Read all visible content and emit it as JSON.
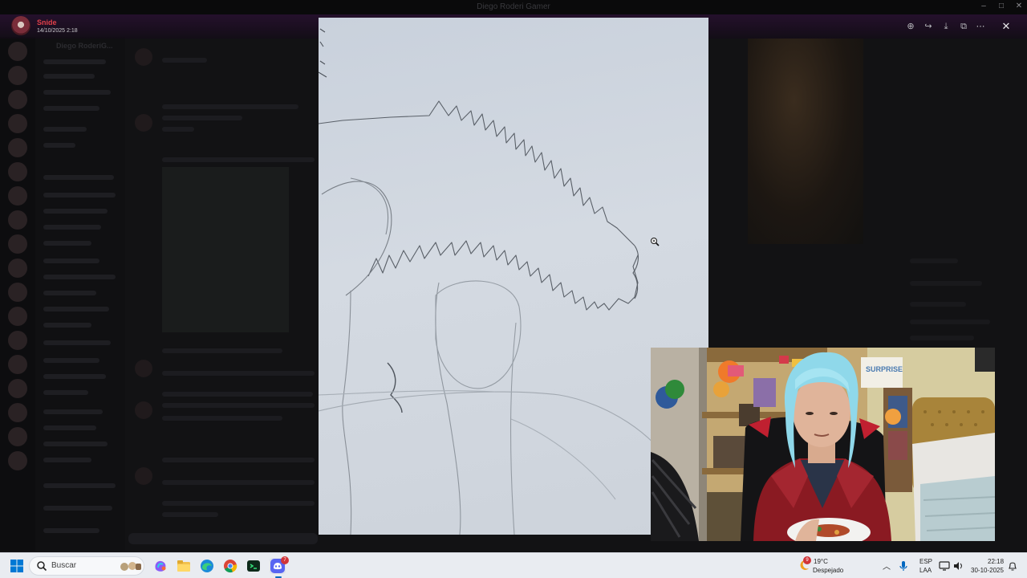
{
  "window": {
    "title": "Diego Roderi Gamer"
  },
  "viewer": {
    "uploader_name": "Snide",
    "uploader_date": "14/10/2025 2:18",
    "toolbar": [
      {
        "name": "zoom-in-icon",
        "glyph": "⊕"
      },
      {
        "name": "forward-icon",
        "glyph": "↪"
      },
      {
        "name": "download-icon",
        "glyph": "⤓"
      },
      {
        "name": "open-external-icon",
        "glyph": "⧉"
      },
      {
        "name": "more-icon",
        "glyph": "⋯"
      }
    ],
    "close_glyph": "✕"
  },
  "background_chat": {
    "server_title": "Diego RoderiG..."
  },
  "taskbar": {
    "search_placeholder": "Buscar",
    "weather_temp": "19°C",
    "weather_desc": "Despejado",
    "weather_badge": "9",
    "lang_top": "ESP",
    "lang_bottom": "LAA",
    "time": "22:18",
    "date": "30-10-2025",
    "discord_badge": "7",
    "apps": [
      "start-icon",
      "search-icon",
      "copilot-icon",
      "file-explorer-icon",
      "edge-icon",
      "chrome-icon",
      "terminal-icon",
      "discord-icon"
    ]
  },
  "colors": {
    "accent_red": "#e0404a",
    "taskbar": "#e9ecf1",
    "paper": "#d0d7df"
  }
}
